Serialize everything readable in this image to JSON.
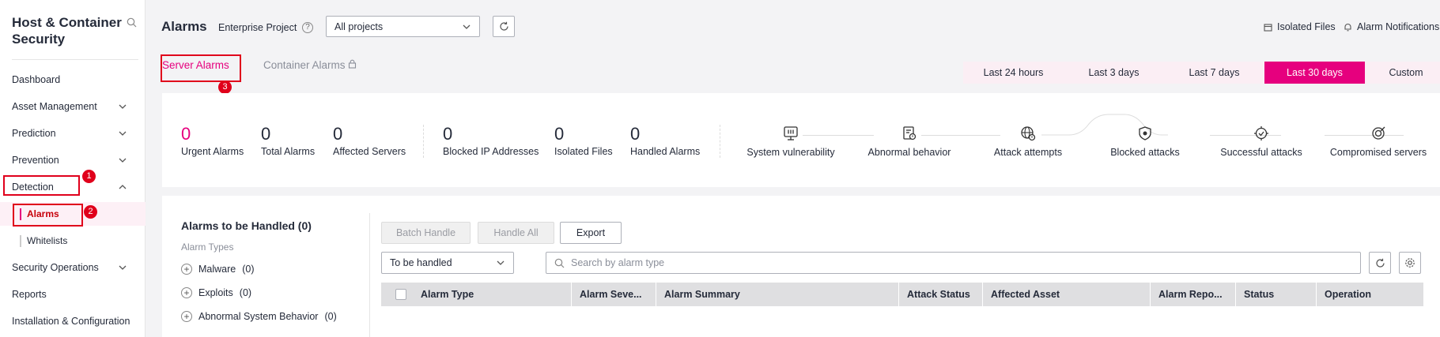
{
  "sidebar": {
    "title": "Host & Container Security",
    "items": [
      {
        "label": "Dashboard"
      },
      {
        "label": "Asset Management"
      },
      {
        "label": "Prediction"
      },
      {
        "label": "Prevention"
      },
      {
        "label": "Detection"
      },
      {
        "label": "Security Operations"
      },
      {
        "label": "Reports"
      },
      {
        "label": "Installation & Configuration"
      }
    ],
    "sub_items": [
      {
        "label": "Alarms"
      },
      {
        "label": "Whitelists"
      }
    ]
  },
  "annotations": [
    "1",
    "2",
    "3"
  ],
  "header": {
    "title": "Alarms",
    "enterprise_label": "Enterprise Project",
    "help_glyph": "?",
    "project_select": "All projects",
    "isolated_files": "Isolated Files",
    "alarm_notifications": "Alarm Notifications"
  },
  "tabs": [
    {
      "label": "Server Alarms"
    },
    {
      "label": "Container Alarms"
    }
  ],
  "time_ranges": [
    {
      "label": "Last 24 hours"
    },
    {
      "label": "Last 3 days"
    },
    {
      "label": "Last 7 days"
    },
    {
      "label": "Last 30 days"
    },
    {
      "label": "Custom"
    }
  ],
  "stats": [
    {
      "value": "0",
      "label": "Urgent Alarms"
    },
    {
      "value": "0",
      "label": "Total Alarms"
    },
    {
      "value": "0",
      "label": "Affected Servers"
    },
    {
      "value": "0",
      "label": "Blocked IP Addresses"
    },
    {
      "value": "0",
      "label": "Isolated Files"
    },
    {
      "value": "0",
      "label": "Handled Alarms"
    }
  ],
  "attack_chain": [
    {
      "label": "System vulnerability"
    },
    {
      "label": "Abnormal behavior"
    },
    {
      "label": "Attack attempts"
    },
    {
      "label": "Blocked attacks"
    },
    {
      "label": "Successful attacks"
    },
    {
      "label": "Compromised servers"
    }
  ],
  "left_panel": {
    "title": "Alarms to be Handled  (0)",
    "subtitle": "Alarm Types",
    "types": [
      {
        "label": "Malware",
        "count": "(0)"
      },
      {
        "label": "Exploits",
        "count": "(0)"
      },
      {
        "label": "Abnormal System Behavior",
        "count": "(0)"
      }
    ]
  },
  "toolbar": {
    "batch_handle": "Batch Handle",
    "handle_all": "Handle All",
    "export": "Export",
    "status_select": "To be handled",
    "search_placeholder": "Search by alarm type"
  },
  "table": {
    "columns": [
      "Alarm Type",
      "Alarm Seve...",
      "Alarm Summary",
      "Attack Status",
      "Affected Asset",
      "Alarm Repo...",
      "Status",
      "Operation"
    ]
  },
  "colors": {
    "accent": "#e6007e",
    "annotation": "#e0001b"
  }
}
